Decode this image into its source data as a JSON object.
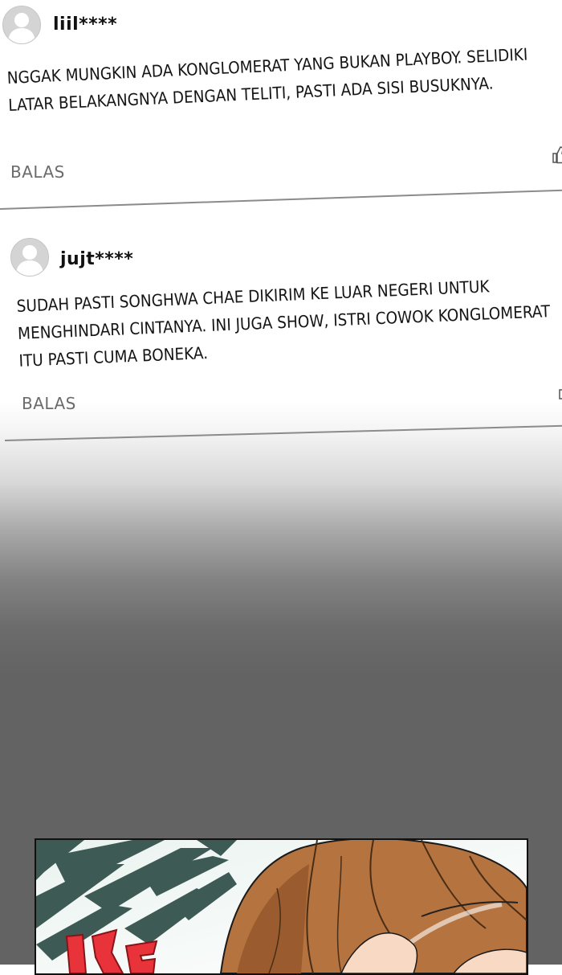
{
  "comments": [
    {
      "username": "liil****",
      "text": "NGGAK MUNGKIN ADA KONGLOMERAT YANG BUKAN PLAYBOY. SELIDIKI LATAR BELAKANGNYA DENGAN TELITI, PASTI ADA SISI BUSUKNYA.",
      "reply_label": "BALAS"
    },
    {
      "username": "jujt****",
      "text": "SUDAH PASTI SONGHWA CHAE DIKIRIM KE LUAR NEGERI UNTUK MENGHINDARI CINTANYA. INI JUGA SHOW, ISTRI COWOK KONGLOMERAT ITU PASTI CUMA BONEKA.",
      "reply_label": "BALAS"
    }
  ],
  "colors": {
    "page_bg": "#ffffff",
    "fade_bg": "#636363",
    "reply_text": "#6b6b6b",
    "divider": "#8b8b8b",
    "hair": "#a8683a",
    "sfx_red": "#e8333b"
  },
  "icons": {
    "avatar": "default-user-avatar-icon",
    "like": "thumbs-up-icon"
  }
}
